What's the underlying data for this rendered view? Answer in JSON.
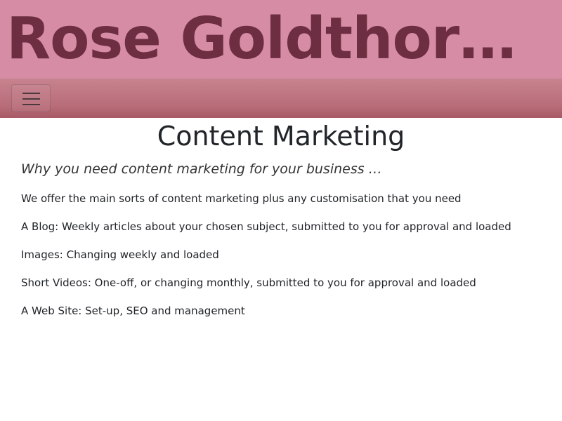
{
  "header": {
    "site_title": "Rose Goldthor…",
    "colors": {
      "banner": "#d68ca4",
      "title_text": "#6d2e42",
      "navbar": "#b86d79"
    }
  },
  "navbar": {
    "toggler_icon": "hamburger-icon"
  },
  "main": {
    "title": "Content Marketing",
    "lead": "Why you need content marketing for your business …",
    "paragraphs": [
      "We offer the main sorts of content marketing plus any customisation that you need",
      "A Blog: Weekly articles about your chosen subject, submitted to you for approval and loaded",
      "Images: Changing weekly and loaded",
      "Short Videos: One-off, or changing monthly, submitted to you for approval and loaded",
      "A Web Site: Set-up, SEO and management"
    ]
  }
}
